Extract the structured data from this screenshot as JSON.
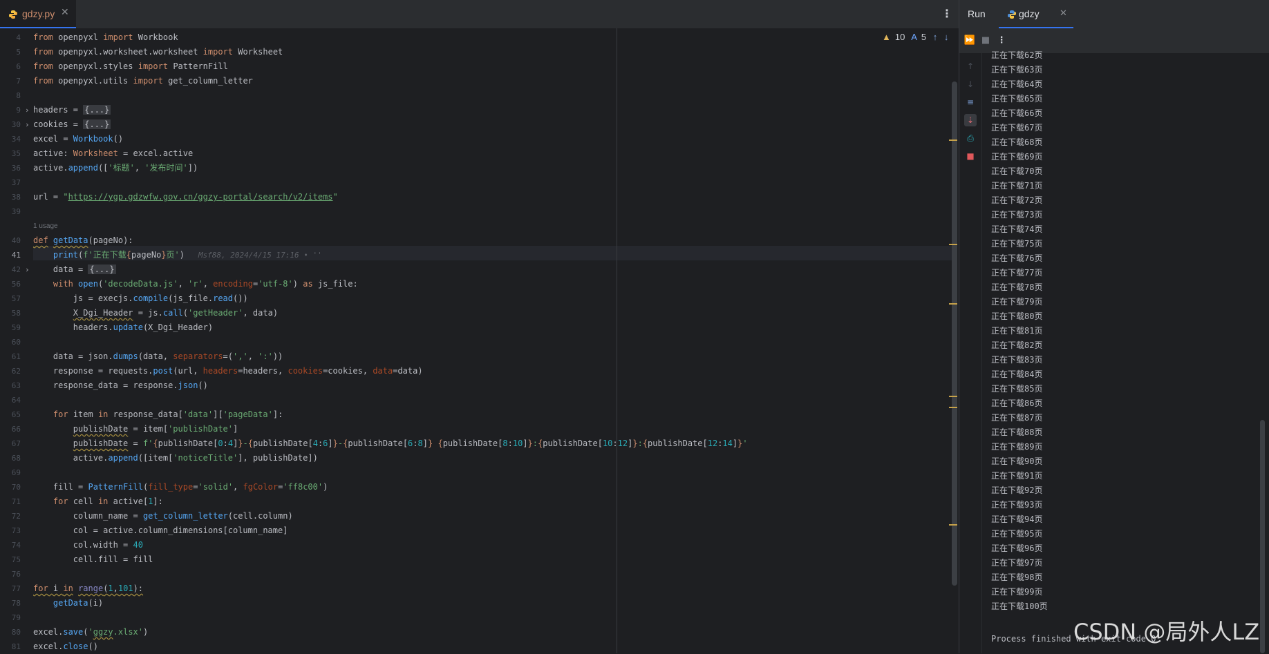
{
  "editor": {
    "tab_name": "gdzy.py",
    "inspection": {
      "warnings": "10",
      "typos": "5"
    },
    "usage_hint": "1 usage",
    "blame": "Msf88, 2024/4/15 17:16 • ''",
    "lines": [
      {
        "n": "4"
      },
      {
        "n": "5"
      },
      {
        "n": "6"
      },
      {
        "n": "7"
      },
      {
        "n": "8"
      },
      {
        "n": "9"
      },
      {
        "n": "30"
      },
      {
        "n": "34"
      },
      {
        "n": "35"
      },
      {
        "n": "36"
      },
      {
        "n": "37"
      },
      {
        "n": "38"
      },
      {
        "n": "39"
      },
      {
        "n": ""
      },
      {
        "n": "40"
      },
      {
        "n": "41"
      },
      {
        "n": "42"
      },
      {
        "n": "56"
      },
      {
        "n": "57"
      },
      {
        "n": "58"
      },
      {
        "n": "59"
      },
      {
        "n": "60"
      },
      {
        "n": "61"
      },
      {
        "n": "62"
      },
      {
        "n": "63"
      },
      {
        "n": "64"
      },
      {
        "n": "65"
      },
      {
        "n": "66"
      },
      {
        "n": "67"
      },
      {
        "n": "68"
      },
      {
        "n": "69"
      },
      {
        "n": "70"
      },
      {
        "n": "71"
      },
      {
        "n": "72"
      },
      {
        "n": "73"
      },
      {
        "n": "74"
      },
      {
        "n": "75"
      },
      {
        "n": "76"
      },
      {
        "n": "77"
      },
      {
        "n": "78"
      },
      {
        "n": "79"
      },
      {
        "n": "80"
      },
      {
        "n": "81"
      }
    ]
  },
  "run": {
    "title": "Run",
    "tab_name": "gdzy",
    "output": [
      "正在下载62页",
      "正在下载63页",
      "正在下载64页",
      "正在下载65页",
      "正在下载66页",
      "正在下载67页",
      "正在下载68页",
      "正在下载69页",
      "正在下载70页",
      "正在下载71页",
      "正在下载72页",
      "正在下载73页",
      "正在下载74页",
      "正在下载75页",
      "正在下载76页",
      "正在下载77页",
      "正在下载78页",
      "正在下载79页",
      "正在下载80页",
      "正在下载81页",
      "正在下载82页",
      "正在下载83页",
      "正在下载84页",
      "正在下载85页",
      "正在下载86页",
      "正在下载87页",
      "正在下载88页",
      "正在下载89页",
      "正在下载90页",
      "正在下载91页",
      "正在下载92页",
      "正在下载93页",
      "正在下载94页",
      "正在下载95页",
      "正在下载96页",
      "正在下载97页",
      "正在下载98页",
      "正在下载99页",
      "正在下载100页"
    ],
    "exit": "Process finished with exit code 0"
  },
  "watermark": "CSDN @局外人LZ",
  "colors": {
    "accent": "#3574f0",
    "bg": "#1e1f22",
    "panel": "#2b2d30",
    "keyword": "#cf8e6d",
    "string": "#6aab73",
    "function": "#56a8f5",
    "number": "#2aacb8"
  },
  "icons": [
    "python-file-icon",
    "close-icon",
    "more-vertical-icon",
    "warning-icon",
    "typo-icon",
    "arrow-up-icon",
    "arrow-down-icon",
    "rerun-icon",
    "stop-icon",
    "scroll-up-icon",
    "scroll-down-icon",
    "soft-wrap-icon",
    "scroll-to-end-icon",
    "print-icon",
    "trash-icon"
  ],
  "code": {
    "l4": [
      "from",
      " openpyxl ",
      "import",
      " Workbook"
    ],
    "l5": [
      "from",
      " openpyxl.worksheet.worksheet ",
      "import",
      " Worksheet"
    ],
    "l6": [
      "from",
      " openpyxl.styles ",
      "import",
      " PatternFill"
    ],
    "l7": [
      "from",
      " openpyxl.utils ",
      "import",
      " get_column_letter"
    ],
    "l9": [
      "headers = ",
      "{...}"
    ],
    "l30": [
      "cookies = ",
      "{...}"
    ],
    "l34": [
      "excel = ",
      "Workbook",
      "()"
    ],
    "l35": [
      "active: ",
      "Worksheet",
      " = excel.active"
    ],
    "l36": [
      "active.",
      "append",
      "([",
      "'标题'",
      ", ",
      "'发布时间'",
      "])"
    ],
    "l38": [
      "url = ",
      "\"",
      "https://ygp.gdzwfw.gov.cn/ggzy-portal/search/v2/items",
      "\""
    ],
    "l40": [
      "def",
      " ",
      "getData",
      "(pageNo):"
    ],
    "l41": [
      "    ",
      "print",
      "(",
      "f'正在下载",
      "{",
      "pageNo",
      "}",
      "页'",
      ")"
    ],
    "l42": [
      "    data = ",
      "{...}"
    ],
    "l56": [
      "    ",
      "with",
      " ",
      "open",
      "(",
      "'decodeData.js'",
      ", ",
      "'r'",
      ", ",
      "encoding",
      "=",
      "'utf-8'",
      ") ",
      "as",
      " js_file:"
    ],
    "l57": [
      "        js = execjs.",
      "compile",
      "(js_file.",
      "read",
      "())"
    ],
    "l58": [
      "        ",
      "X_Dgi_Header",
      " = js.",
      "call",
      "(",
      "'getHeader'",
      ", data)"
    ],
    "l59": [
      "        headers.",
      "update",
      "(X_Dgi_Header)"
    ],
    "l61": [
      "    data = json.",
      "dumps",
      "(data, ",
      "separators",
      "=(",
      "','",
      ", ",
      "':'",
      "))"
    ],
    "l62": [
      "    response = requests.",
      "post",
      "(url, ",
      "headers",
      "=headers, ",
      "cookies",
      "=cookies, ",
      "data",
      "=data)"
    ],
    "l63": [
      "    response_data = response.",
      "json",
      "()"
    ],
    "l65": [
      "    ",
      "for",
      " item ",
      "in",
      " response_data[",
      "'data'",
      "][",
      "'pageData'",
      "]:"
    ],
    "l66": [
      "        ",
      "publishDate",
      " = item[",
      "'publishDate'",
      "]"
    ],
    "l67": [
      "        ",
      "publishDate",
      " = ",
      "f'",
      "{",
      "publishDate[",
      "0",
      ":",
      "4",
      "]",
      "}",
      "-",
      "{",
      "publishDate[",
      "4",
      ":",
      "6",
      "]",
      "}",
      "-",
      "{",
      "publishDate[",
      "6",
      ":",
      "8",
      "]",
      "}",
      " ",
      "{",
      "publishDate[",
      "8",
      ":",
      "10",
      "]",
      "}",
      ":",
      "{",
      "publishDate[",
      "10",
      ":",
      "12",
      "]",
      "}",
      ":",
      "{",
      "publishDate[",
      "12",
      ":",
      "14",
      "]",
      "}",
      "'"
    ],
    "l68": [
      "        active.",
      "append",
      "([item[",
      "'noticeTitle'",
      "], publishDate])"
    ],
    "l70": [
      "    fill = ",
      "PatternFill",
      "(",
      "fill_type",
      "=",
      "'solid'",
      ", ",
      "fgColor",
      "=",
      "'ff8c00'",
      ")"
    ],
    "l71": [
      "    ",
      "for",
      " cell ",
      "in",
      " active[",
      "1",
      "]:"
    ],
    "l72": [
      "        column_name = ",
      "get_column_letter",
      "(cell.column)"
    ],
    "l73": [
      "        col = active.column_dimensions[column_name]"
    ],
    "l74": [
      "        col.width = ",
      "40"
    ],
    "l75": [
      "        cell.fill = fill"
    ],
    "l77": [
      "for",
      " i ",
      "in",
      " ",
      "range",
      "(",
      "1",
      ",",
      "101",
      "):"
    ],
    "l78": [
      "    ",
      "getData",
      "(i)"
    ],
    "l80": [
      "excel.",
      "save",
      "(",
      "'",
      "ggzy",
      ".xlsx'",
      ")"
    ],
    "l81": [
      "excel.",
      "close",
      "()"
    ]
  }
}
